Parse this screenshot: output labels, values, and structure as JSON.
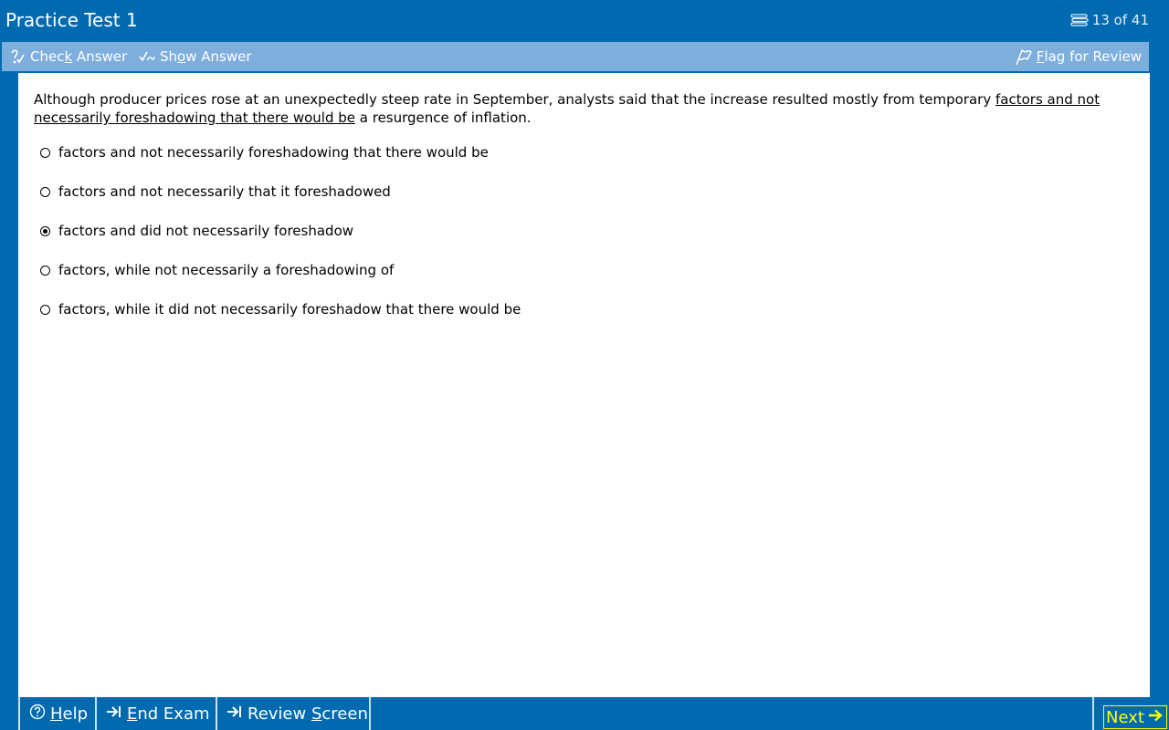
{
  "app": {
    "title": "Practice Test 1",
    "progress": "13 of 41"
  },
  "toolbar": {
    "check_answer_pre": "Chec",
    "check_answer_key": "k",
    "check_answer_post": " Answer",
    "show_answer_pre": "Sh",
    "show_answer_key": "o",
    "show_answer_post": "w Answer",
    "flag_key": "F",
    "flag_post": "lag for Review"
  },
  "question": {
    "stem_before": "Although producer prices rose at an unexpectedly steep rate in September, analysts said that the increase resulted mostly from temporary ",
    "stem_underlined": "factors and not necessarily foreshadowing that there would be",
    "stem_after": " a resurgence of inflation.",
    "options": [
      {
        "label": "factors and not necessarily foreshadowing that there would be",
        "selected": false
      },
      {
        "label": "factors and not necessarily that it foreshadowed",
        "selected": false
      },
      {
        "label": "factors and did not necessarily foreshadow",
        "selected": true
      },
      {
        "label": "factors, while not necessarily a foreshadowing of",
        "selected": false
      },
      {
        "label": "factors, while it did not necessarily foreshadow that there would be",
        "selected": false
      }
    ]
  },
  "bottombar": {
    "help_key": "H",
    "help_post": "elp",
    "end_key": "E",
    "end_post": "nd Exam",
    "review_pre": "Review ",
    "review_key": "S",
    "review_post": "creen",
    "next_label": "Next"
  },
  "icons": {
    "progress": "stack-icon",
    "check": "check-answer-icon",
    "show": "show-answer-icon",
    "flag": "flag-icon",
    "help": "help-circle-icon",
    "end": "end-exam-arrow-icon",
    "review": "review-arrow-icon",
    "next": "right-arrow-icon"
  },
  "colors": {
    "frame": "#006ab1",
    "toolbar": "#7eaedc",
    "next_accent": "#ffff00"
  }
}
